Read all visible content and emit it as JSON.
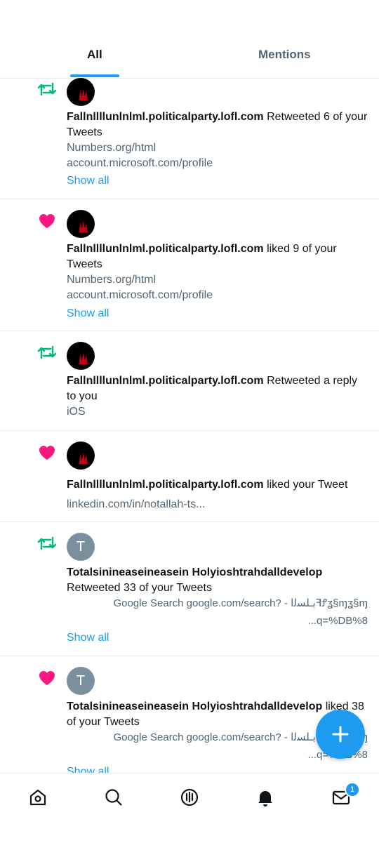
{
  "tabs": [
    {
      "label": "All",
      "active": true
    },
    {
      "label": "Mentions",
      "active": false
    }
  ],
  "notifications": [
    {
      "type": "retweet",
      "name": "Fallnllllunlnlml.politicalparty.lofl.com",
      "action": " Retweeted 6 of your Tweets",
      "meta1": "Numbers.org/html",
      "meta2": "account.microsoft.com/profile",
      "show_all": "Show all"
    },
    {
      "type": "like",
      "name": "Fallnllllunlnlml.politicalparty.lofl.com",
      "action": " liked 9 of your Tweets",
      "meta1": "Numbers.org/html",
      "meta2": "account.microsoft.com/profile",
      "show_all": "Show all"
    },
    {
      "type": "retweet",
      "name": "Fallnllllunlnlml.politicalparty.lofl.com",
      "action": " Retweeted a reply to you",
      "meta1": "iOS"
    },
    {
      "type": "like",
      "name": "Fallnllllunlnlml.politicalparty.lofl.com",
      "action": " liked your Tweet",
      "meta1": "linkedin.com/in/notallah-ts..."
    },
    {
      "type": "retweet",
      "avatar_letter": "T",
      "name": "Totalsinineaseineasein Holyioshtrahdalldevelop",
      "action": "Retweeted 33 of your Tweets",
      "meta1": "Google Search google.com/search? - ‎ﺑـ‏ﻠﺴﻟﺍ‏ꟻꝬ‏ʓ§ɱ‏ʓ§ɱ",
      "meta2": "...q=%DB%8",
      "show_all": "Show all"
    },
    {
      "type": "like",
      "avatar_letter": "T",
      "name": "Totalsinineaseineasein Holyioshtrahdalldevelop",
      "action": " liked 38 of your Tweets",
      "meta1": "Google Search google.com/search? - ‎ﺑـ‏ﻠﺴﻟﺍ‏ꟻꝬ‏ʓ§ɱ‏ʓ§ɱ",
      "meta2": "...q=%DB%8",
      "show_all": "Show all"
    }
  ],
  "fab": {
    "icon": "plus-icon"
  },
  "bottom_nav": {
    "items": [
      "home-icon",
      "search-icon",
      "spaces-icon",
      "notifications-icon",
      "messages-icon"
    ],
    "messages_badge": "1"
  },
  "colors": {
    "accent": "#1d9bf0",
    "retweet": "#00ba7c",
    "like": "#f91880",
    "secondary_text": "#536471"
  }
}
